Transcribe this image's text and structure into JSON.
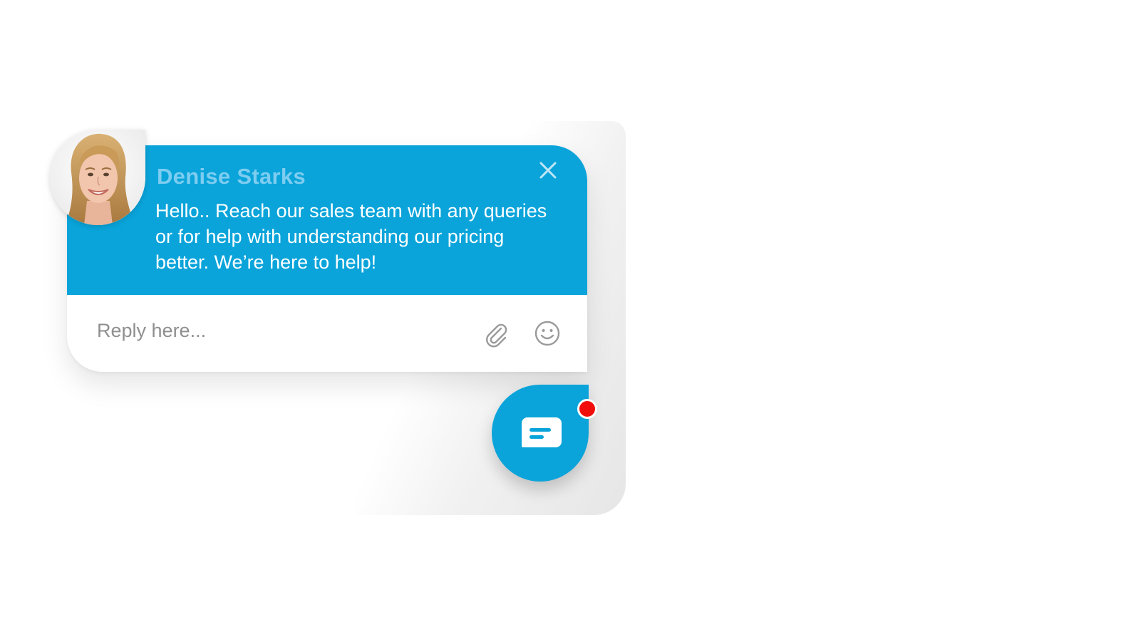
{
  "chat_widget": {
    "agent_name": "Denise Starks",
    "message": "Hello.. Reach our sales team with any queries or for help with understanding our pricing better. We’re here to help!",
    "reply_placeholder": "Reply here...",
    "colors": {
      "brand": "#0aa4da",
      "agent_name": "#7ecdf0",
      "notification": "#f20d0d"
    },
    "icons": {
      "close": "close-icon",
      "attach": "paperclip-icon",
      "emoji": "smiley-icon",
      "launcher": "chat-bubble-icon"
    },
    "launcher": {
      "has_notification": true
    }
  }
}
